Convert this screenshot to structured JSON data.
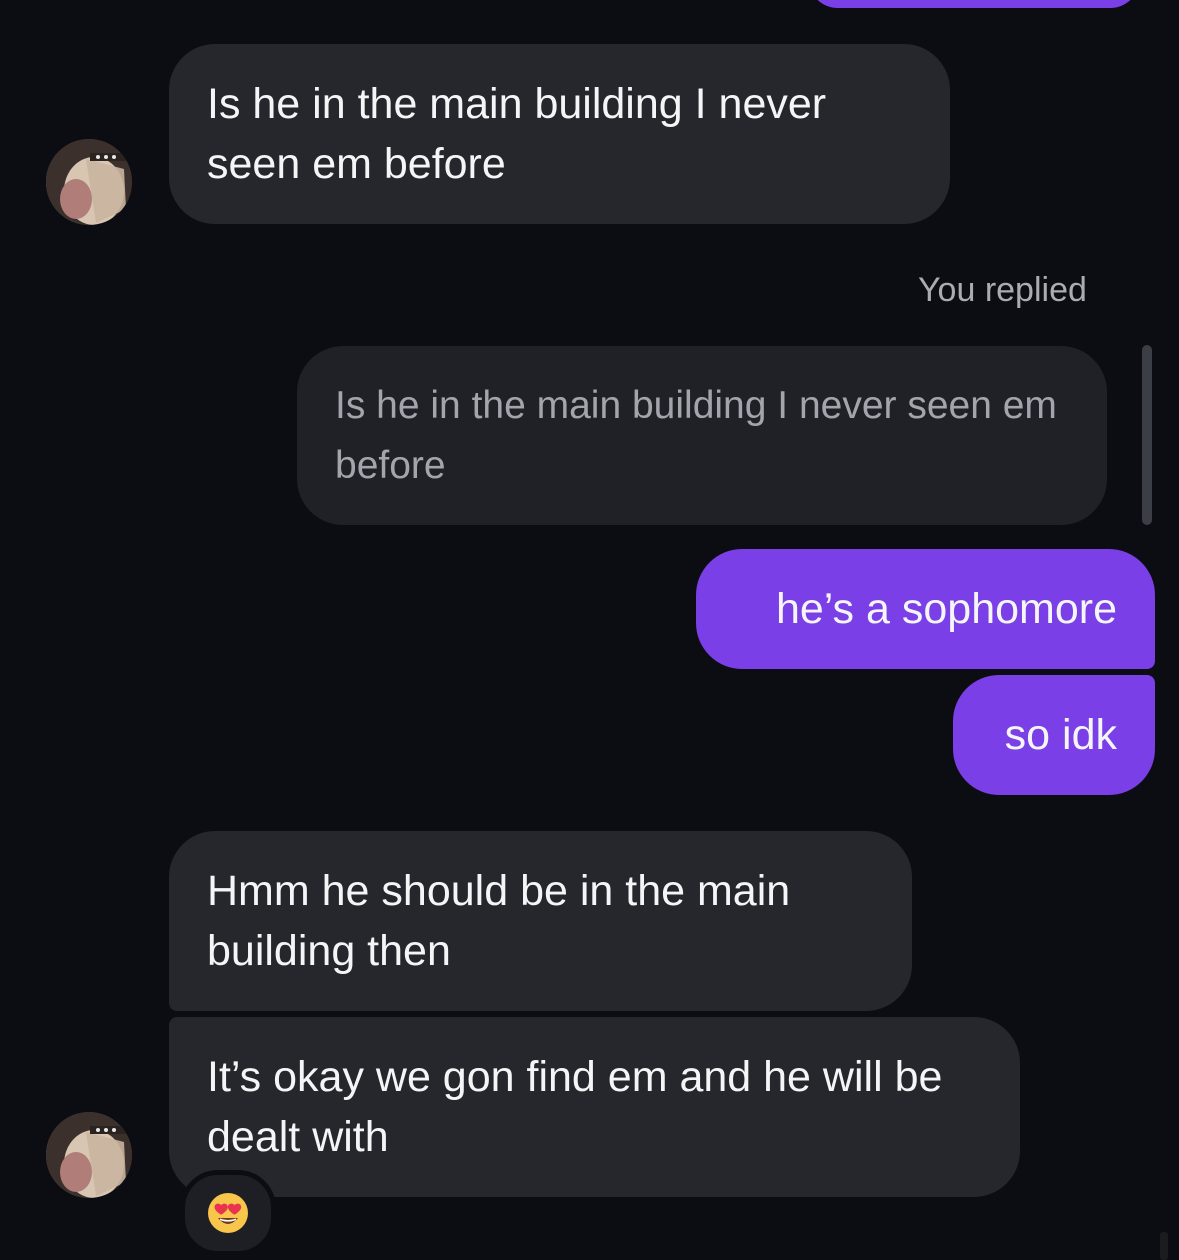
{
  "messages": [
    {
      "id": "m1",
      "sender": "them",
      "text": "Is he in the main building I never seen em before"
    },
    {
      "id": "m2",
      "sender": "me",
      "reply_label": "You replied",
      "quoted_text": "Is he in the main building I never seen em before"
    },
    {
      "id": "m3",
      "sender": "me",
      "text": "he’s a sophomore"
    },
    {
      "id": "m4",
      "sender": "me",
      "text": "so idk"
    },
    {
      "id": "m5",
      "sender": "them",
      "text": "Hmm he should be in the main building then"
    },
    {
      "id": "m6",
      "sender": "them",
      "text": "It’s okay we gon find em and he will be dealt with",
      "reaction": "heart-eyes-emoji"
    }
  ],
  "colors": {
    "background": "#0b0d12",
    "incoming_bubble": "#25272c",
    "outgoing_bubble": "#7a3fe6",
    "quote_bubble": "#1f2126",
    "secondary_text": "#a9acb2"
  },
  "icons": {
    "avatar": "profile-avatar",
    "reaction": "heart-eyes-emoji"
  }
}
